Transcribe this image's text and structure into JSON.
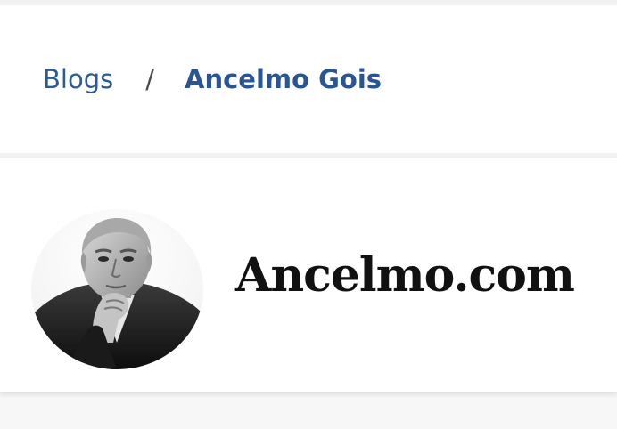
{
  "breadcrumb": {
    "parent_label": "Blogs",
    "separator": "/",
    "current_label": "Ancelmo Gois"
  },
  "blog_header": {
    "title": "Ancelmo.com",
    "avatar_icon": "columnist-portrait"
  },
  "colors": {
    "link_blue": "#2c5b94",
    "title_black": "#111111"
  }
}
